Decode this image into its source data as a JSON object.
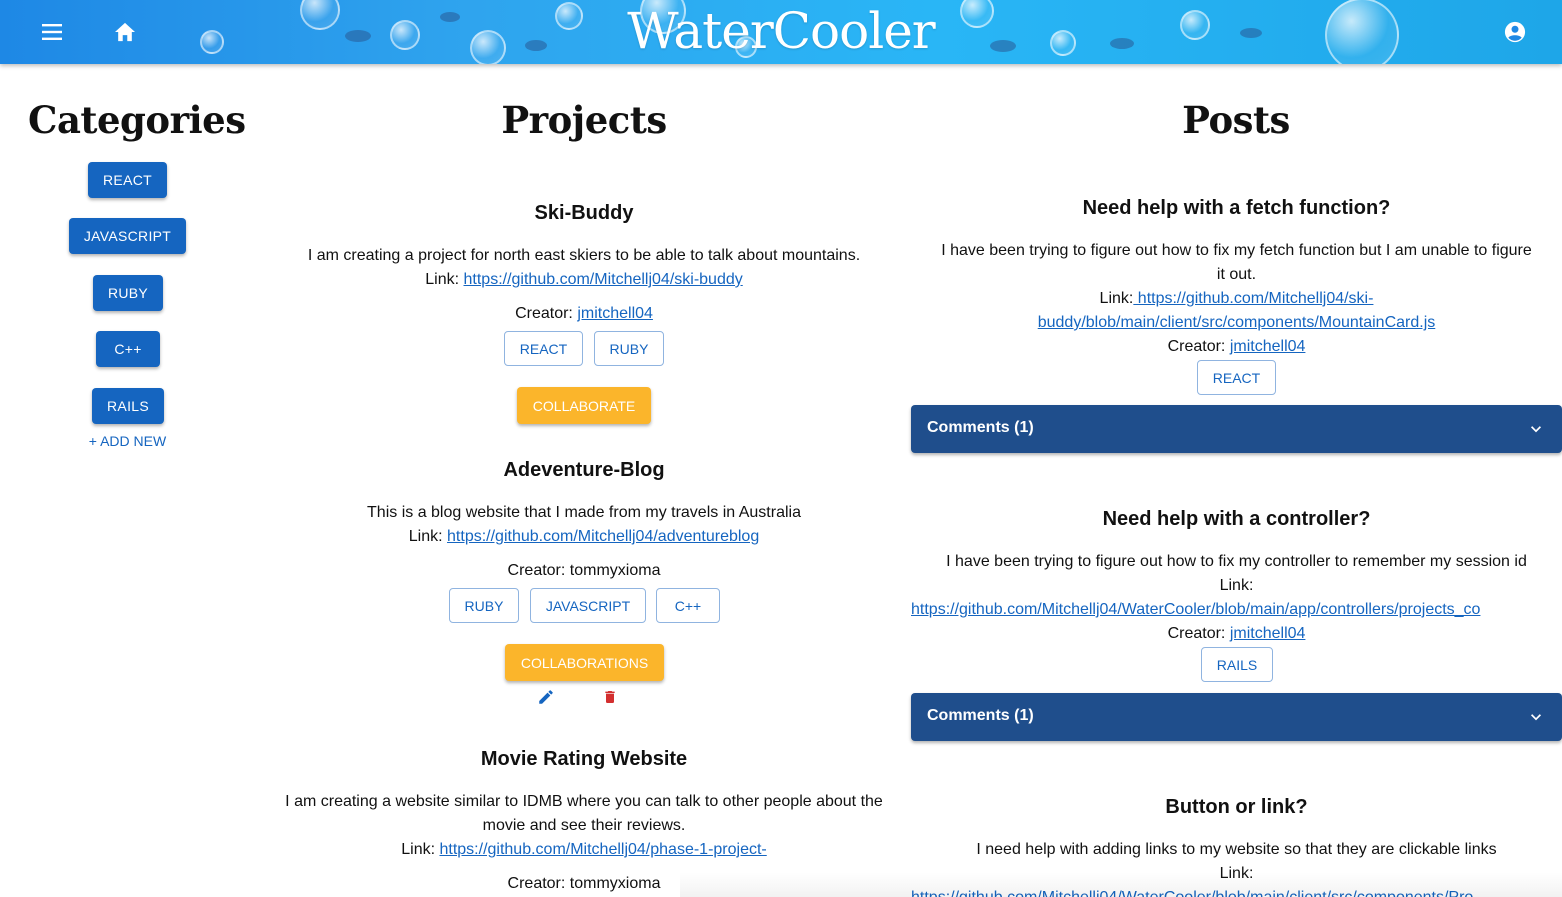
{
  "header": {
    "brand": "WaterCooler",
    "menu_icon": "menu-icon",
    "home_icon": "home-icon",
    "account_icon": "account-circle-icon"
  },
  "categories": {
    "title": "Categories",
    "items": [
      "REACT",
      "JAVASCRIPT",
      "RUBY",
      "C++",
      "RAILS"
    ],
    "add_new": "+ ADD NEW"
  },
  "projects": {
    "title": "Projects",
    "items": [
      {
        "name": "Ski-Buddy",
        "description": "I am creating a project for north east skiers to be able to talk about mountains.",
        "link_label": "Link:",
        "link": "https://github.com/Mitchellj04/ski-buddy",
        "creator_label": "Creator:",
        "creator": "jmitchell04",
        "tags": [
          "REACT",
          "RUBY"
        ],
        "action": "COLLABORATE"
      },
      {
        "name": "Adeventure-Blog",
        "description": "This is a blog website that I made from my travels in Australia",
        "link_label": "Link:",
        "link": "https://github.com/Mitchellj04/adventureblog",
        "creator_label": "Creator:",
        "creator": "tommyxioma",
        "tags": [
          "RUBY",
          "JAVASCRIPT",
          "C++"
        ],
        "action": "COLLABORATIONS",
        "edit_icon": "pencil-icon",
        "delete_icon": "trash-icon"
      },
      {
        "name": "Movie Rating Website",
        "description_line1": "I am creating a website similar to IDMB where you can talk to other people about the",
        "description_line2": "movie and see their reviews.",
        "link_label": "Link:",
        "link": "https://github.com/Mitchellj04/phase-1-project-",
        "creator_label": "Creator:",
        "creator": "tommyxioma"
      }
    ]
  },
  "posts": {
    "title": "Posts",
    "items": [
      {
        "title": "Need help with a fetch function?",
        "body_line1": "I have been trying to figure out how to fix my fetch function but I am unable to figure",
        "body_line2": "it out.",
        "link_label": "Link:",
        "link_line1": " https://github.com/Mitchellj04/ski-",
        "link_line2": "buddy/blob/main/client/src/components/MountainCard.js",
        "creator_label": "Creator:",
        "creator": "jmitchell04",
        "tag": "REACT",
        "comments": "Comments (1)"
      },
      {
        "title": "Need help with a controller?",
        "body_line1": "I have been trying to figure out how to fix my controller to remember my session id",
        "link_label": "Link:",
        "link": "https://github.com/Mitchellj04/WaterCooler/blob/main/app/controllers/projects_co",
        "creator_label": "Creator:",
        "creator": "jmitchell04",
        "tag": "RAILS",
        "comments": "Comments (1)"
      },
      {
        "title": "Button or link?",
        "body_line1": "I need help with adding links to my website so that they are clickable links",
        "link_label": "Link:",
        "link": "https://github.com/Mitchellj04/WaterCooler/blob/main/client/src/components/Pro"
      }
    ]
  },
  "colors": {
    "primary": "#1565c0",
    "accent": "#fbb52b",
    "accordion": "#1f4e8c",
    "delete": "#d32f2f"
  }
}
